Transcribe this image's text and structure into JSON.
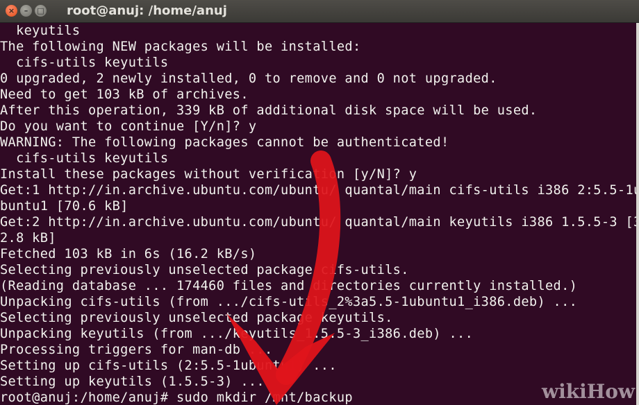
{
  "window": {
    "title": "root@anuj: /home/anuj"
  },
  "controls": {
    "close": "×",
    "minimize": "–",
    "maximize": "□"
  },
  "terminal": {
    "lines": [
      "  keyutils",
      "The following NEW packages will be installed:",
      "  cifs-utils keyutils",
      "0 upgraded, 2 newly installed, 0 to remove and 0 not upgraded.",
      "Need to get 103 kB of archives.",
      "After this operation, 339 kB of additional disk space will be used.",
      "Do you want to continue [Y/n]? y",
      "WARNING: The following packages cannot be authenticated!",
      "  cifs-utils keyutils",
      "Install these packages without verification [y/N]? y",
      "Get:1 http://in.archive.ubuntu.com/ubuntu/ quantal/main cifs-utils i386 2:5.5-1u",
      "buntu1 [70.6 kB]",
      "Get:2 http://in.archive.ubuntu.com/ubuntu/ quantal/main keyutils i386 1.5.5-3 [3",
      "2.8 kB]",
      "Fetched 103 kB in 6s (16.2 kB/s)",
      "Selecting previously unselected package cifs-utils.",
      "(Reading database ... 174460 files and directories currently installed.)",
      "Unpacking cifs-utils (from .../cifs-utils_2%3a5.5-1ubuntu1_i386.deb) ...",
      "Selecting previously unselected package keyutils.",
      "Unpacking keyutils (from .../keyutils_1.5.5-3_i386.deb) ...",
      "Processing triggers for man-db ...",
      "Setting up cifs-utils (2:5.5-1ubuntu1) ...",
      "Setting up keyutils (1.5.5-3) ...",
      "root@anuj:/home/anuj# sudo mkdir /mnt/backup"
    ]
  },
  "watermark": {
    "part1": "wiki",
    "part2": "How"
  },
  "colors": {
    "background": "#300a24",
    "text": "#f2f2ee",
    "arrow": "#e0141b"
  }
}
